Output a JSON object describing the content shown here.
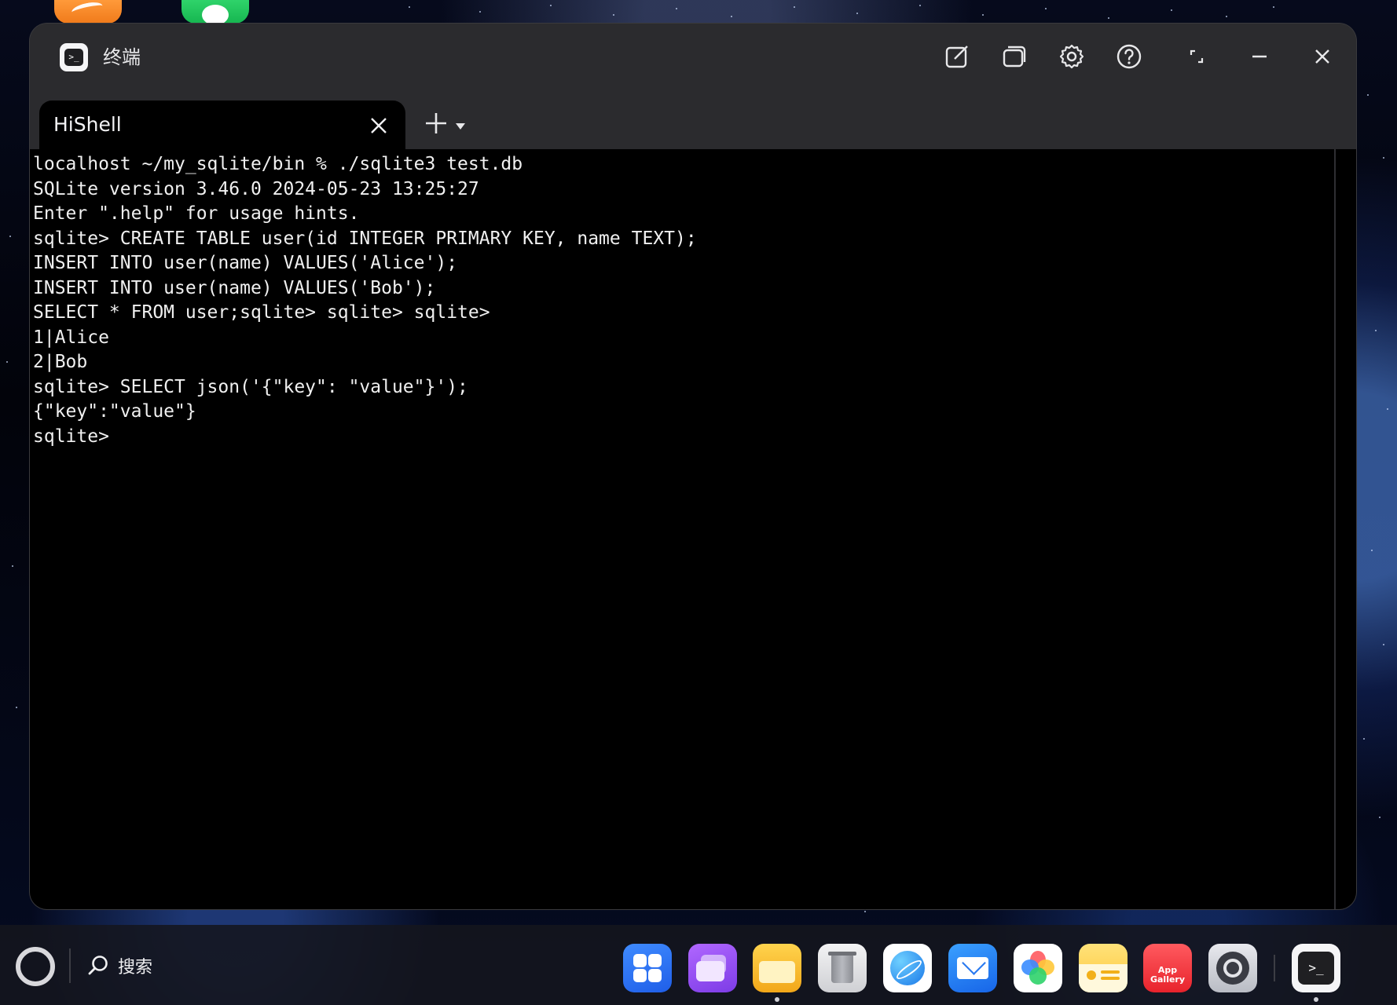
{
  "window": {
    "title": "终端",
    "app_icon": "terminal-icon"
  },
  "titlebar_buttons": [
    {
      "name": "new-window-icon"
    },
    {
      "name": "multi-window-icon"
    },
    {
      "name": "gear-icon"
    },
    {
      "name": "help-icon"
    },
    {
      "name": "restore-icon"
    },
    {
      "name": "minimize-icon"
    },
    {
      "name": "close-icon"
    }
  ],
  "tabs": [
    {
      "label": "HiShell",
      "active": true
    }
  ],
  "terminal": {
    "lines": [
      "localhost ~/my_sqlite/bin % ./sqlite3 test.db",
      "SQLite version 3.46.0 2024-05-23 13:25:27",
      "Enter \".help\" for usage hints.",
      "sqlite> CREATE TABLE user(id INTEGER PRIMARY KEY, name TEXT);",
      "INSERT INTO user(name) VALUES('Alice');",
      "INSERT INTO user(name) VALUES('Bob');",
      "SELECT * FROM user;sqlite> sqlite> sqlite>",
      "1|Alice",
      "2|Bob",
      "sqlite> SELECT json('{\"key\": \"value\"}');",
      "{\"key\":\"value\"}",
      "sqlite>"
    ],
    "background": "#000000",
    "foreground": "#f0f0f0"
  },
  "taskbar": {
    "search_label": "搜索",
    "dock": [
      {
        "name": "app-launcher-icon"
      },
      {
        "name": "multitask-icon"
      },
      {
        "name": "files-icon",
        "running": true
      },
      {
        "name": "trash-icon"
      },
      {
        "name": "browser-icon"
      },
      {
        "name": "mail-icon"
      },
      {
        "name": "photos-icon"
      },
      {
        "name": "notes-icon"
      },
      {
        "name": "app-gallery-icon",
        "label_line1": "App",
        "label_line2": "Gallery"
      },
      {
        "name": "settings-icon"
      },
      {
        "name": "terminal-dock-icon",
        "running": true
      }
    ]
  }
}
